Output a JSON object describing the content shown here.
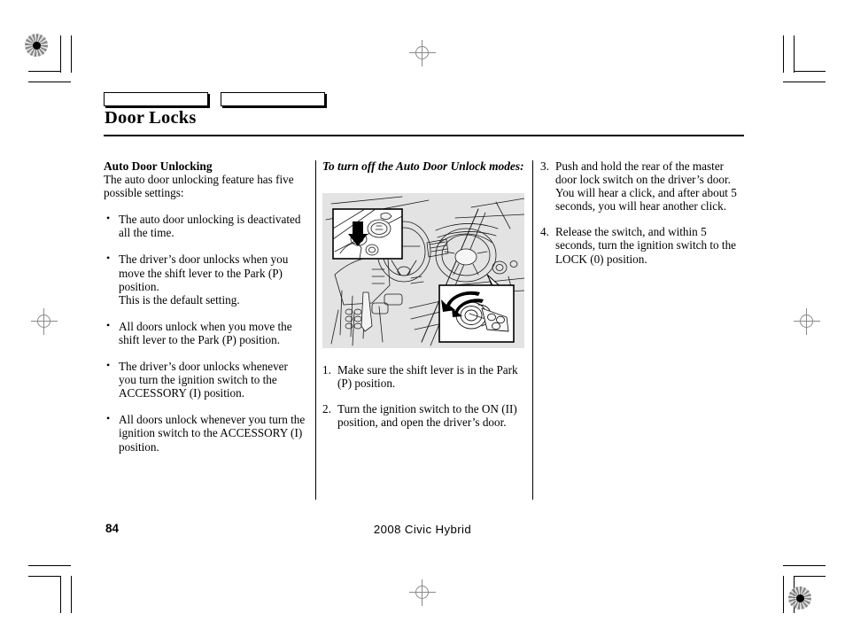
{
  "page": {
    "title": "Door Locks",
    "folio": "84",
    "footer_model": "2008  Civic  Hybrid",
    "tabs": [
      {
        "label": ""
      },
      {
        "label": ""
      }
    ]
  },
  "left_column": {
    "heading": "Auto Door Unlocking",
    "intro": "The auto door unlocking feature has five possible settings:",
    "bullets": [
      {
        "text": "The auto door unlocking is deactivated all the time.",
        "extra": ""
      },
      {
        "text": "The driver’s door unlocks when you move the shift lever to the Park (P) position.",
        "extra": "This is the default setting."
      },
      {
        "text": "All doors unlock when you move the shift lever to the Park (P) position.",
        "extra": ""
      },
      {
        "text": "The driver’s door unlocks whenever you turn the ignition switch to the ACCESSORY (I) position.",
        "extra": ""
      },
      {
        "text": "All doors unlock whenever you turn the ignition switch to the ACCESSORY (I) position.",
        "extra": ""
      }
    ]
  },
  "middle_column": {
    "heading": "To turn off the Auto Door Unlock modes:",
    "figure": {
      "name": "car-interior-ignition-illustration",
      "background_color": "#e3e3e3",
      "callouts": [
        "master-door-lock-switch-detail",
        "ignition-key-turn-detail"
      ]
    },
    "steps": [
      {
        "num": "1.",
        "text": "Make sure the shift lever is in the Park (P) position."
      },
      {
        "num": "2.",
        "text": "Turn the ignition switch to the ON (II) position, and open the driver’s door."
      }
    ]
  },
  "right_column": {
    "steps": [
      {
        "num": "3.",
        "text": "Push and hold the rear of the master door lock switch on the driver’s door. You will hear a click, and after about 5 seconds, you will hear another click."
      },
      {
        "num": "4.",
        "text": "Release the switch, and within 5 seconds, turn the ignition switch to the LOCK (0) position."
      }
    ]
  },
  "print_marks": {
    "registration_targets": 2,
    "crosshairs": 4,
    "corner_crop_marks": 4
  }
}
